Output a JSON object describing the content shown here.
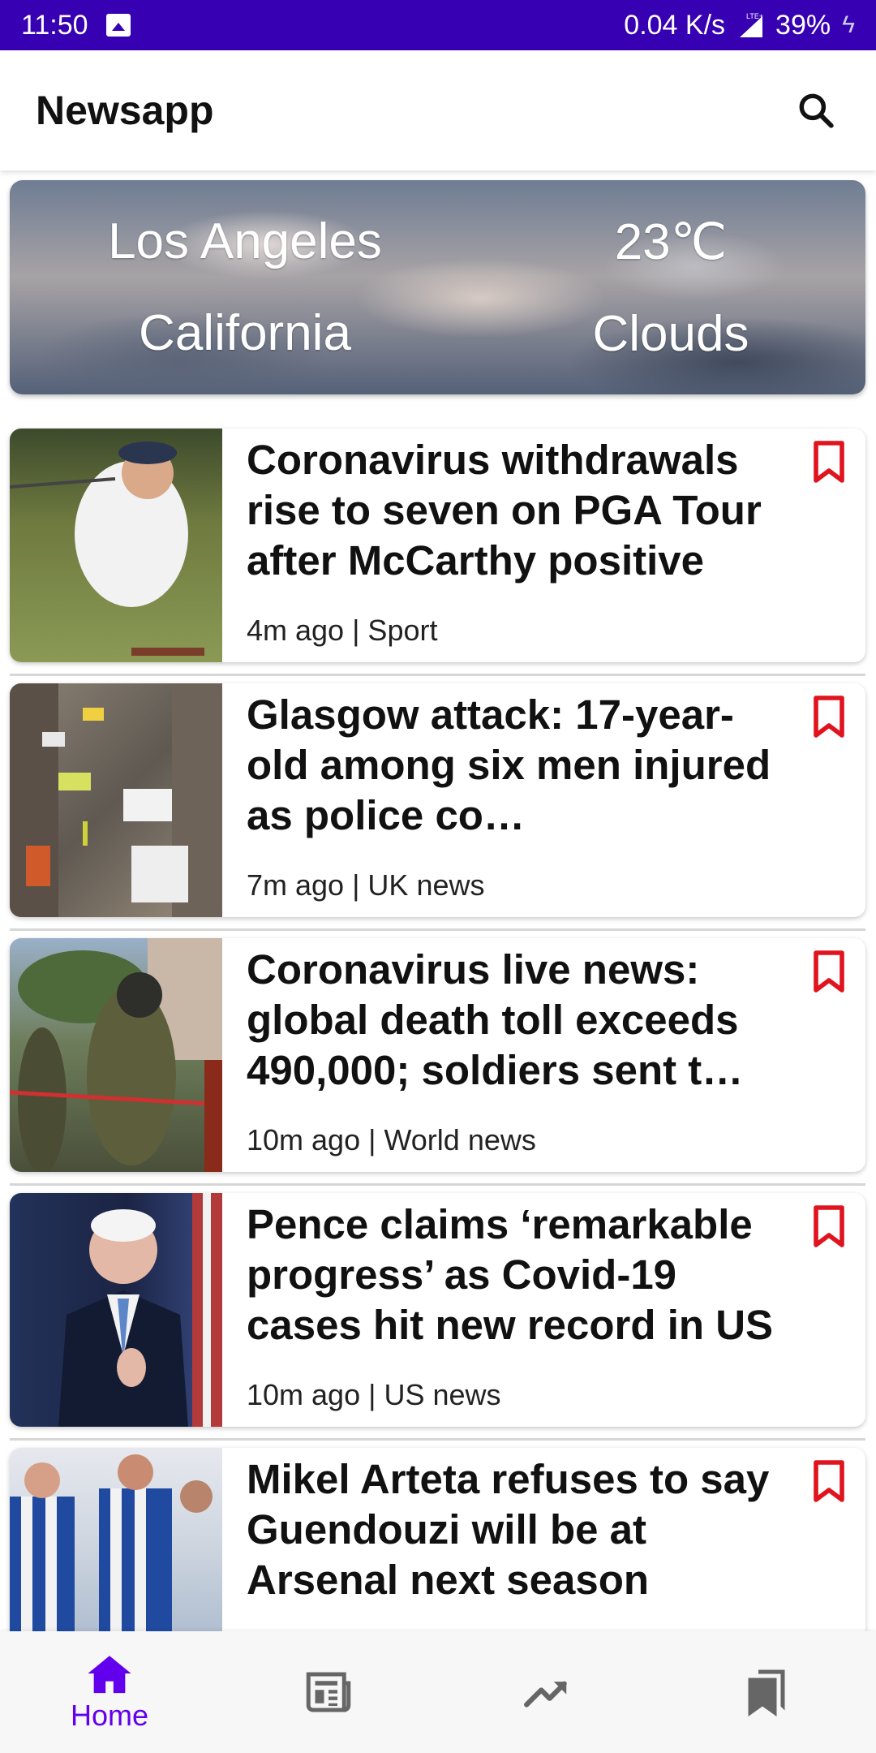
{
  "status_bar": {
    "time": "11:50",
    "network_speed": "0.04 K/s",
    "network_type": "LTE+",
    "battery": "39%",
    "icons": [
      "image-icon",
      "signal-icon",
      "battery-charging-icon"
    ]
  },
  "app_bar": {
    "title": "Newsapp",
    "search_icon": "search-icon"
  },
  "weather": {
    "city": "Los Angeles",
    "region": "California",
    "temperature": "23℃",
    "condition": "Clouds"
  },
  "articles": [
    {
      "headline": "Coronavirus withdrawals rise to seven on PGA Tour after McCarthy positive",
      "meta": "4m ago | Sport",
      "bookmark_icon": "bookmark-outline-icon"
    },
    {
      "headline": "Glasgow attack: 17-year-old among six men injured as police co…",
      "meta": "7m ago | UK news",
      "bookmark_icon": "bookmark-outline-icon"
    },
    {
      "headline": "Coronavirus live news: global death toll exceeds 490,000; soldiers sent t…",
      "meta": "10m ago | World news",
      "bookmark_icon": "bookmark-outline-icon"
    },
    {
      "headline": "Pence claims ‘remarkable progress’ as Covid-19 cases hit new record in US",
      "meta": "10m ago | US news",
      "bookmark_icon": "bookmark-outline-icon"
    },
    {
      "headline": "Mikel Arteta refuses to say Guendouzi will be at Arsenal next season",
      "meta": "",
      "bookmark_icon": "bookmark-outline-icon"
    }
  ],
  "bottom_nav": {
    "items": [
      {
        "label": "Home",
        "icon": "home-icon",
        "active": true
      },
      {
        "label": "",
        "icon": "newspaper-icon",
        "active": false
      },
      {
        "label": "",
        "icon": "trending-icon",
        "active": false
      },
      {
        "label": "",
        "icon": "bookmarks-icon",
        "active": false
      }
    ]
  },
  "colors": {
    "status_bar": "#3700b3",
    "accent": "#6200ee",
    "bookmark": "#e0141e",
    "inactive_icon": "#666666"
  }
}
